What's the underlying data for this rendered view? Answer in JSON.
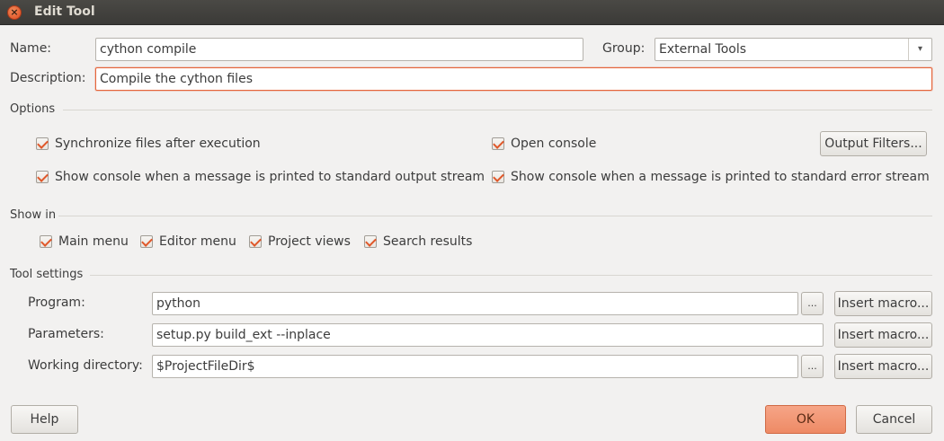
{
  "window": {
    "title": "Edit Tool",
    "close_glyph": "×"
  },
  "name": {
    "label": "Name:",
    "value": "cython compile"
  },
  "group": {
    "label": "Group:",
    "value": "External Tools",
    "arrow": "▾"
  },
  "description": {
    "label": "Description:",
    "value": "Compile the cython files"
  },
  "options": {
    "section": "Options",
    "sync_files": "Synchronize files after execution",
    "open_console": "Open console",
    "output_filters": "Output Filters...",
    "console_stdout": "Show console when a message is printed to standard output stream",
    "console_stderr": "Show console when a message is printed to standard error stream"
  },
  "show_in": {
    "section": "Show in",
    "main_menu": "Main menu",
    "editor_menu": "Editor menu",
    "project_views": "Project views",
    "search_results": "Search results"
  },
  "tool_settings": {
    "section": "Tool settings",
    "program_label": "Program:",
    "program_value": "python",
    "parameters_label": "Parameters:",
    "parameters_value": "setup.py build_ext --inplace",
    "working_dir_label": "Working directory:",
    "working_dir_value": "$ProjectFileDir$",
    "browse": "...",
    "insert_macro": "Insert macro..."
  },
  "footer": {
    "help": "Help",
    "ok": "OK",
    "cancel": "Cancel"
  },
  "colors": {
    "accent": "#e0582a",
    "ok_button": "#ee8a65",
    "titlebar": "#3b3a37"
  }
}
